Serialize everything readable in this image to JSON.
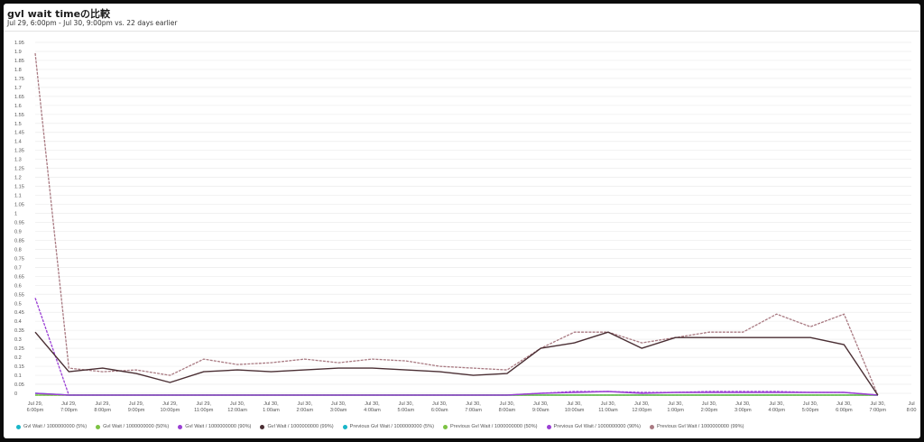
{
  "header": {
    "title": "gvl wait timeの比較",
    "subtitle": "Jul 29, 6:00pm - Jul 30, 9:00pm vs. 22 days earlier"
  },
  "chart_data": {
    "type": "line",
    "title": "gvl wait timeの比較",
    "subtitle": "Jul 29, 6:00pm - Jul 30, 9:00pm vs. 22 days earlier",
    "xlabel": "",
    "ylabel": "",
    "ylim": [
      0,
      1.95
    ],
    "y_ticks": [
      "0",
      "0.05",
      "0.1",
      "0.15",
      "0.2",
      "0.25",
      "0.3",
      "0.35",
      "0.4",
      "0.45",
      "0.5",
      "0.55",
      "0.6",
      "0.65",
      "0.7",
      "0.75",
      "0.8",
      "0.85",
      "0.9",
      "0.95",
      "1",
      "1.05",
      "1.1",
      "1.15",
      "1.2",
      "1.25",
      "1.3",
      "1.35",
      "1.4",
      "1.45",
      "1.5",
      "1.55",
      "1.6",
      "1.65",
      "1.7",
      "1.75",
      "1.8",
      "1.85",
      "1.9",
      "1.95"
    ],
    "x_ticks": [
      [
        "Jul 29,",
        "6:00pm"
      ],
      [
        "Jul 29,",
        "7:00pm"
      ],
      [
        "Jul 29,",
        "8:00pm"
      ],
      [
        "Jul 29,",
        "9:00pm"
      ],
      [
        "Jul 29,",
        "10:00pm"
      ],
      [
        "Jul 29,",
        "11:00pm"
      ],
      [
        "Jul 30,",
        "12:00am"
      ],
      [
        "Jul 30,",
        "1:00am"
      ],
      [
        "Jul 30,",
        "2:00am"
      ],
      [
        "Jul 30,",
        "3:00am"
      ],
      [
        "Jul 30,",
        "4:00am"
      ],
      [
        "Jul 30,",
        "5:00am"
      ],
      [
        "Jul 30,",
        "6:00am"
      ],
      [
        "Jul 30,",
        "7:00am"
      ],
      [
        "Jul 30,",
        "8:00am"
      ],
      [
        "Jul 30,",
        "9:00am"
      ],
      [
        "Jul 30,",
        "10:00am"
      ],
      [
        "Jul 30,",
        "11:00am"
      ],
      [
        "Jul 30,",
        "12:00pm"
      ],
      [
        "Jul 30,",
        "1:00pm"
      ],
      [
        "Jul 30,",
        "2:00pm"
      ],
      [
        "Jul 30,",
        "3:00pm"
      ],
      [
        "Jul 30,",
        "4:00pm"
      ],
      [
        "Jul 30,",
        "5:00pm"
      ],
      [
        "Jul 30,",
        "6:00pm"
      ],
      [
        "Jul 30,",
        "7:00pm"
      ],
      [
        "Jul",
        "8:00"
      ]
    ],
    "grid": true,
    "legend_position": "bottom",
    "series": [
      {
        "name": "Gvl Wait / 1000000000 (5%)",
        "color": "#19b6c8",
        "dashed": false,
        "values": [
          0,
          -0.01,
          -0.01,
          -0.01,
          -0.01,
          -0.01,
          -0.01,
          -0.01,
          -0.01,
          -0.01,
          -0.01,
          -0.01,
          -0.01,
          -0.01,
          -0.01,
          -0.01,
          -0.01,
          -0.01,
          -0.01,
          -0.01,
          -0.01,
          -0.01,
          -0.01,
          -0.01,
          -0.01,
          -0.01
        ]
      },
      {
        "name": "Gvl Wait / 1000000000 (50%)",
        "color": "#7cc243",
        "dashed": false,
        "values": [
          -0.01,
          -0.01,
          -0.01,
          -0.01,
          -0.01,
          -0.01,
          -0.01,
          -0.01,
          -0.01,
          -0.01,
          -0.01,
          -0.01,
          -0.01,
          -0.01,
          -0.01,
          -0.01,
          -0.01,
          -0.01,
          -0.01,
          -0.01,
          -0.01,
          -0.01,
          -0.01,
          -0.01,
          -0.01,
          -0.01
        ]
      },
      {
        "name": "Gvl Wait / 1000000000 (90%)",
        "color": "#9a3fd4",
        "dashed": false,
        "values": [
          0,
          -0.01,
          -0.01,
          -0.01,
          -0.01,
          -0.01,
          -0.01,
          -0.01,
          -0.01,
          -0.01,
          -0.01,
          -0.01,
          -0.01,
          -0.01,
          -0.01,
          0.0,
          0.005,
          0.01,
          0.0,
          0.005,
          0.005,
          0.005,
          0.005,
          0.005,
          0.005,
          -0.01
        ]
      },
      {
        "name": "Gvl Wait / 1000000000 (99%)",
        "color": "#4a2e33",
        "dashed": false,
        "values": [
          0.34,
          0.12,
          0.14,
          0.11,
          0.06,
          0.12,
          0.13,
          0.12,
          0.13,
          0.14,
          0.14,
          0.13,
          0.12,
          0.1,
          0.11,
          0.25,
          0.28,
          0.34,
          0.25,
          0.31,
          0.31,
          0.31,
          0.31,
          0.31,
          0.27,
          -0.01
        ]
      },
      {
        "name": "Previous Gvl Wait / 1000000000 (5%)",
        "color": "#19b6c8",
        "dashed": true,
        "values": [
          -0.01,
          -0.01,
          -0.01,
          -0.01,
          -0.01,
          -0.01,
          -0.01,
          -0.01,
          -0.01,
          -0.01,
          -0.01,
          -0.01,
          -0.01,
          -0.01,
          -0.01,
          -0.01,
          -0.01,
          -0.01,
          -0.01,
          -0.01,
          -0.01,
          -0.01,
          -0.01,
          -0.01,
          -0.01,
          -0.01
        ]
      },
      {
        "name": "Previous Gvl Wait / 1000000000 (50%)",
        "color": "#7cc243",
        "dashed": true,
        "values": [
          -0.01,
          -0.01,
          -0.01,
          -0.01,
          -0.01,
          -0.01,
          -0.01,
          -0.01,
          -0.01,
          -0.01,
          -0.01,
          -0.01,
          -0.01,
          -0.01,
          -0.01,
          -0.01,
          -0.01,
          -0.01,
          -0.01,
          -0.01,
          -0.01,
          -0.01,
          -0.01,
          -0.01,
          -0.01,
          -0.01
        ]
      },
      {
        "name": "Previous Gvl Wait / 1000000000 (90%)",
        "color": "#9a3fd4",
        "dashed": true,
        "values": [
          0.53,
          -0.01,
          -0.01,
          -0.01,
          -0.01,
          -0.01,
          -0.01,
          -0.01,
          -0.01,
          -0.01,
          -0.01,
          -0.01,
          -0.01,
          -0.01,
          -0.01,
          0.0,
          0.01,
          0.01,
          0.005,
          0.005,
          0.01,
          0.01,
          0.01,
          0.005,
          0.005,
          -0.01
        ]
      },
      {
        "name": "Previous Gvl Wait / 1000000000 (99%)",
        "color": "#a97a82",
        "dashed": true,
        "values": [
          1.89,
          0.14,
          0.12,
          0.13,
          0.1,
          0.19,
          0.16,
          0.17,
          0.19,
          0.17,
          0.19,
          0.18,
          0.15,
          0.14,
          0.13,
          0.25,
          0.34,
          0.34,
          0.28,
          0.31,
          0.34,
          0.34,
          0.44,
          0.37,
          0.44,
          -0.01
        ]
      }
    ]
  }
}
